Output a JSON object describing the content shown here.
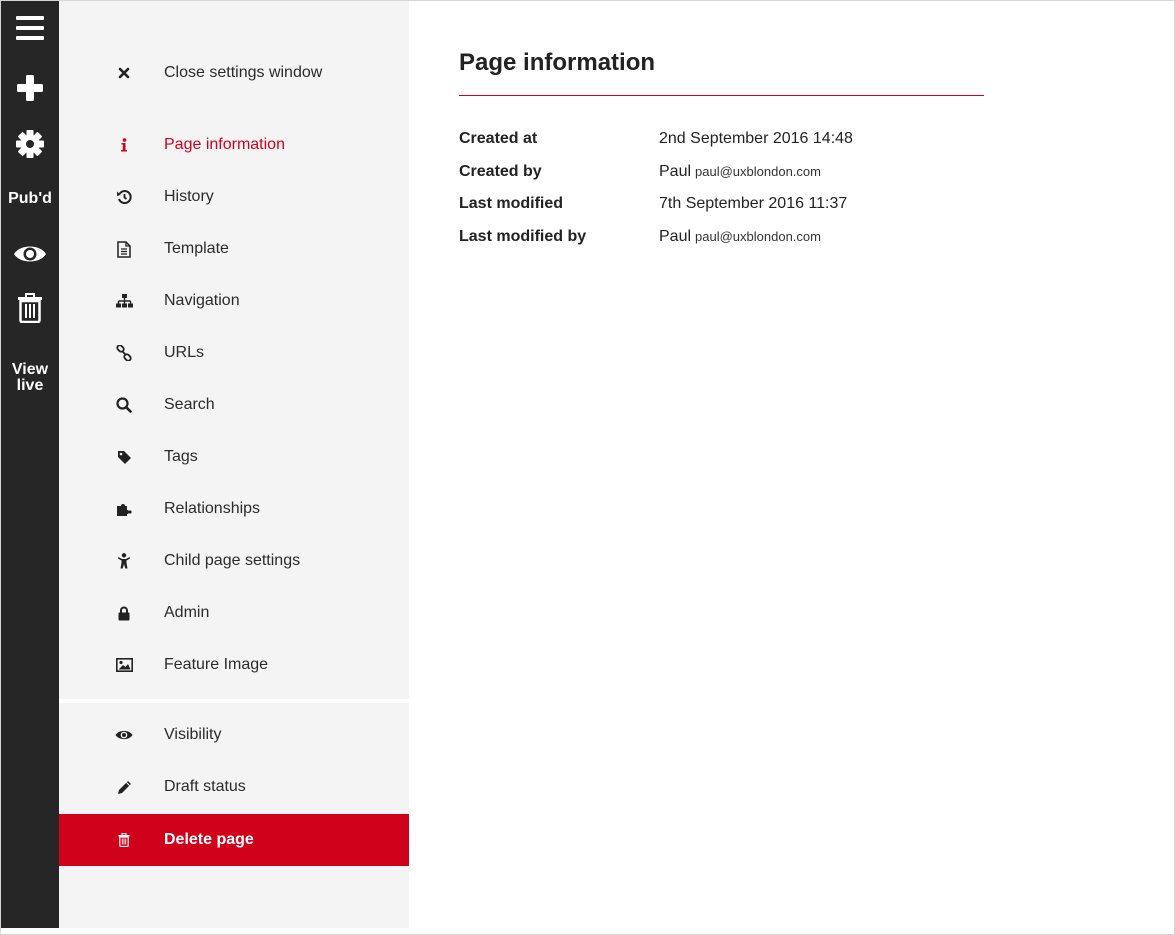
{
  "toolbar": {
    "menu_icon": "hamburger-icon",
    "add_icon": "plus-icon",
    "settings_icon": "gear-icon",
    "publish_label": "Pub'd",
    "preview_icon": "eye-icon",
    "delete_icon": "trash-icon",
    "view_live_line1": "View",
    "view_live_line2": "live"
  },
  "settings_panel": {
    "close_label": "Close settings window",
    "items": [
      {
        "label": "Page information",
        "icon": "info-icon",
        "active": true
      },
      {
        "label": "History",
        "icon": "history-icon"
      },
      {
        "label": "Template",
        "icon": "document-icon"
      },
      {
        "label": "Navigation",
        "icon": "sitemap-icon"
      },
      {
        "label": "URLs",
        "icon": "link-icon"
      },
      {
        "label": "Search",
        "icon": "search-icon"
      },
      {
        "label": "Tags",
        "icon": "tag-icon"
      },
      {
        "label": "Relationships",
        "icon": "puzzle-icon"
      },
      {
        "label": "Child page settings",
        "icon": "child-icon"
      },
      {
        "label": "Admin",
        "icon": "lock-icon"
      },
      {
        "label": "Feature Image",
        "icon": "image-icon"
      }
    ],
    "secondary_items": [
      {
        "label": "Visibility",
        "icon": "eye-icon"
      },
      {
        "label": "Draft status",
        "icon": "pencil-icon"
      }
    ],
    "delete_label": "Delete page"
  },
  "page_info": {
    "title": "Page information",
    "rows": [
      {
        "label": "Created at",
        "value": "2nd September 2016 14:48",
        "email": ""
      },
      {
        "label": "Created by",
        "value": "Paul",
        "email": "paul@uxblondon.com"
      },
      {
        "label": "Last modified",
        "value": "7th September 2016 11:37",
        "email": ""
      },
      {
        "label": "Last modified by",
        "value": "Paul",
        "email": "paul@uxblondon.com"
      }
    ]
  },
  "colors": {
    "accent": "#d0021b",
    "toolbar_bg": "#262626",
    "panel_bg": "#f4f4f4"
  }
}
